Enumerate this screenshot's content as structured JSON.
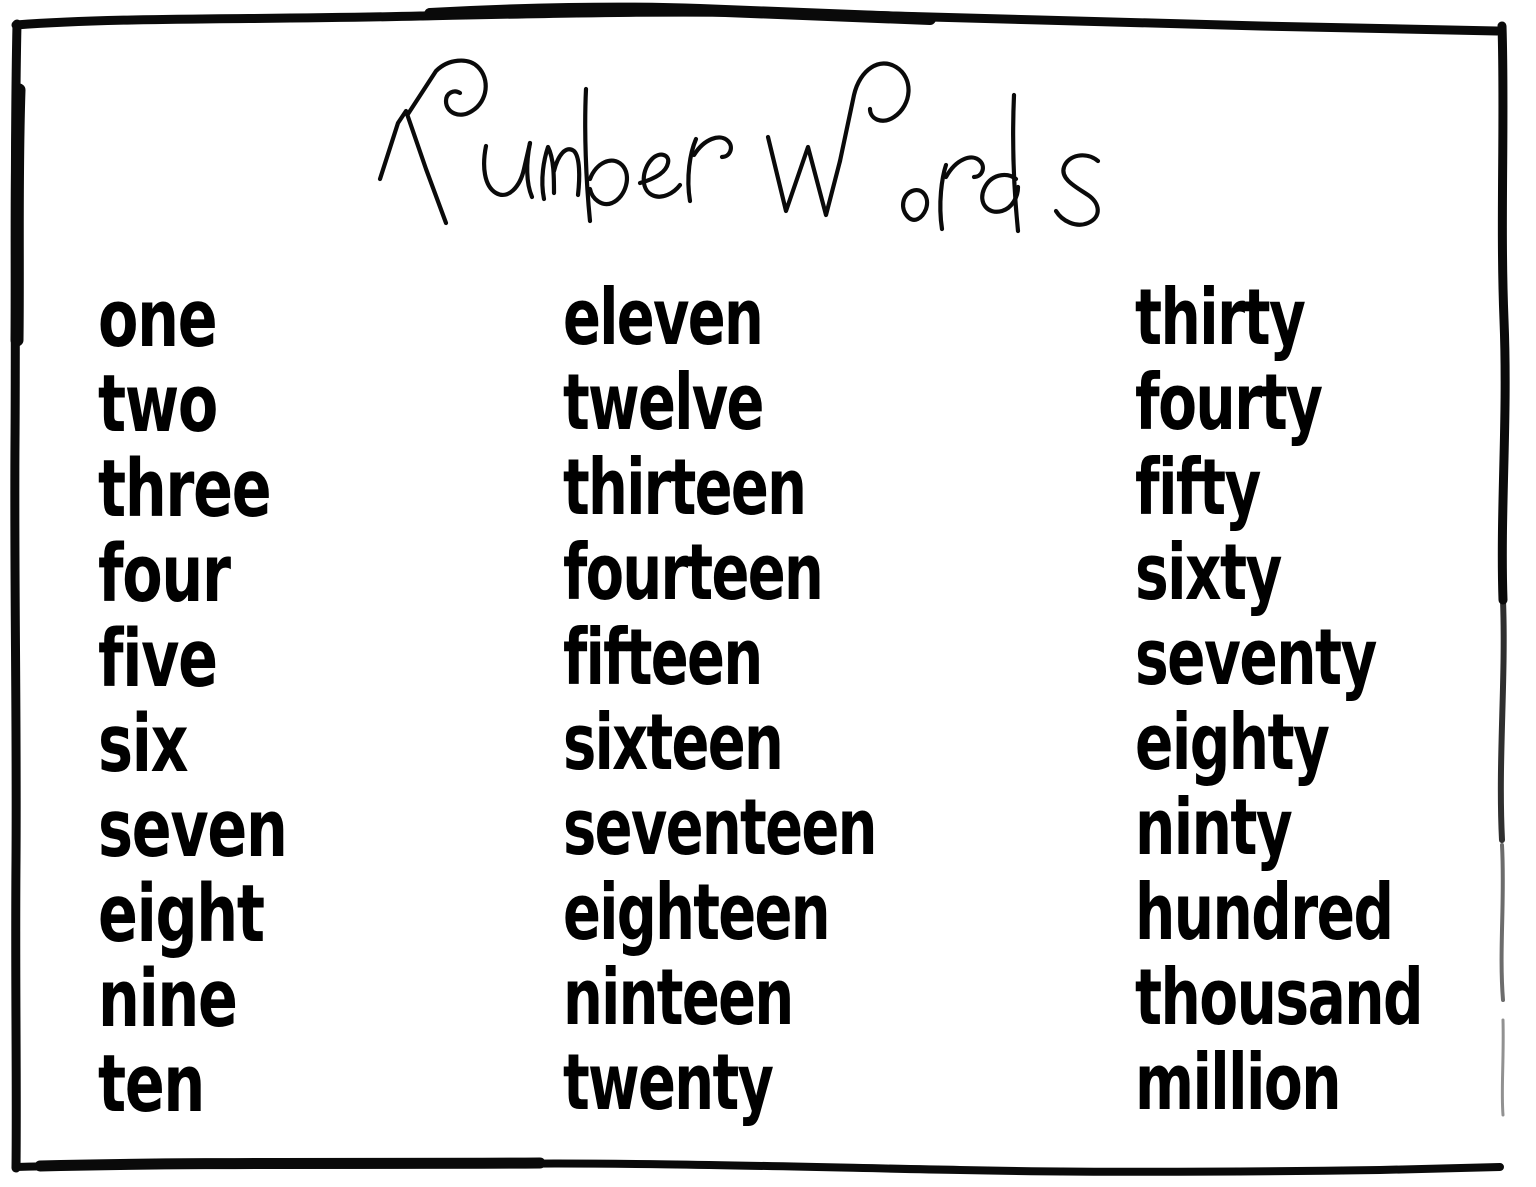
{
  "poster": {
    "title": "Number Words",
    "title_word_1": "Number",
    "title_word_2": "Words",
    "background_color": "#ffffff",
    "ink_color": "#000000"
  },
  "columns": [
    {
      "name": "ones-column",
      "words": [
        "one",
        "two",
        "three",
        "four",
        "five",
        "six",
        "seven",
        "eight",
        "nine",
        "ten"
      ]
    },
    {
      "name": "teens-column",
      "words": [
        "eleven",
        "twelve",
        "thirteen",
        "fourteen",
        "fifteen",
        "sixteen",
        "seventeen",
        "eighteen",
        "ninteen",
        "twenty"
      ]
    },
    {
      "name": "tens-and-large-column",
      "words": [
        "thirty",
        "fourty",
        "fifty",
        "sixty",
        "seventy",
        "eighty",
        "ninty",
        "hundred",
        "thousand",
        "million"
      ]
    }
  ]
}
